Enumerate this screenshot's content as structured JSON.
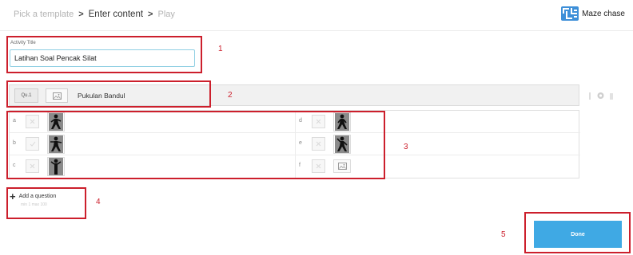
{
  "breadcrumb": {
    "steps": [
      "Pick a template",
      "Enter content",
      "Play"
    ],
    "separator": ">"
  },
  "template": {
    "name": "Maze chase",
    "icon": "maze-icon",
    "accent": "#3d8fd8"
  },
  "activity": {
    "title_label": "Activity Title",
    "title_value": "Latihan Soal Pencak Silat"
  },
  "question": {
    "number_label": "Qu.1",
    "text": "Pukulan Bandul",
    "image_icon": "image-icon"
  },
  "answers": {
    "left": [
      {
        "letter": "a",
        "type": "figure"
      },
      {
        "letter": "b",
        "type": "figure"
      },
      {
        "letter": "c",
        "type": "figure"
      }
    ],
    "right": [
      {
        "letter": "d",
        "type": "figure"
      },
      {
        "letter": "e",
        "type": "figure"
      },
      {
        "letter": "f",
        "type": "empty"
      }
    ]
  },
  "add_question": {
    "label": "Add a question",
    "hint": "min 1  max 100"
  },
  "done_button": {
    "label": "Done",
    "color": "#3fa9e4"
  },
  "annotations": {
    "color": "#cc1f2c",
    "labels": [
      "1",
      "2",
      "3",
      "4",
      "5"
    ]
  }
}
